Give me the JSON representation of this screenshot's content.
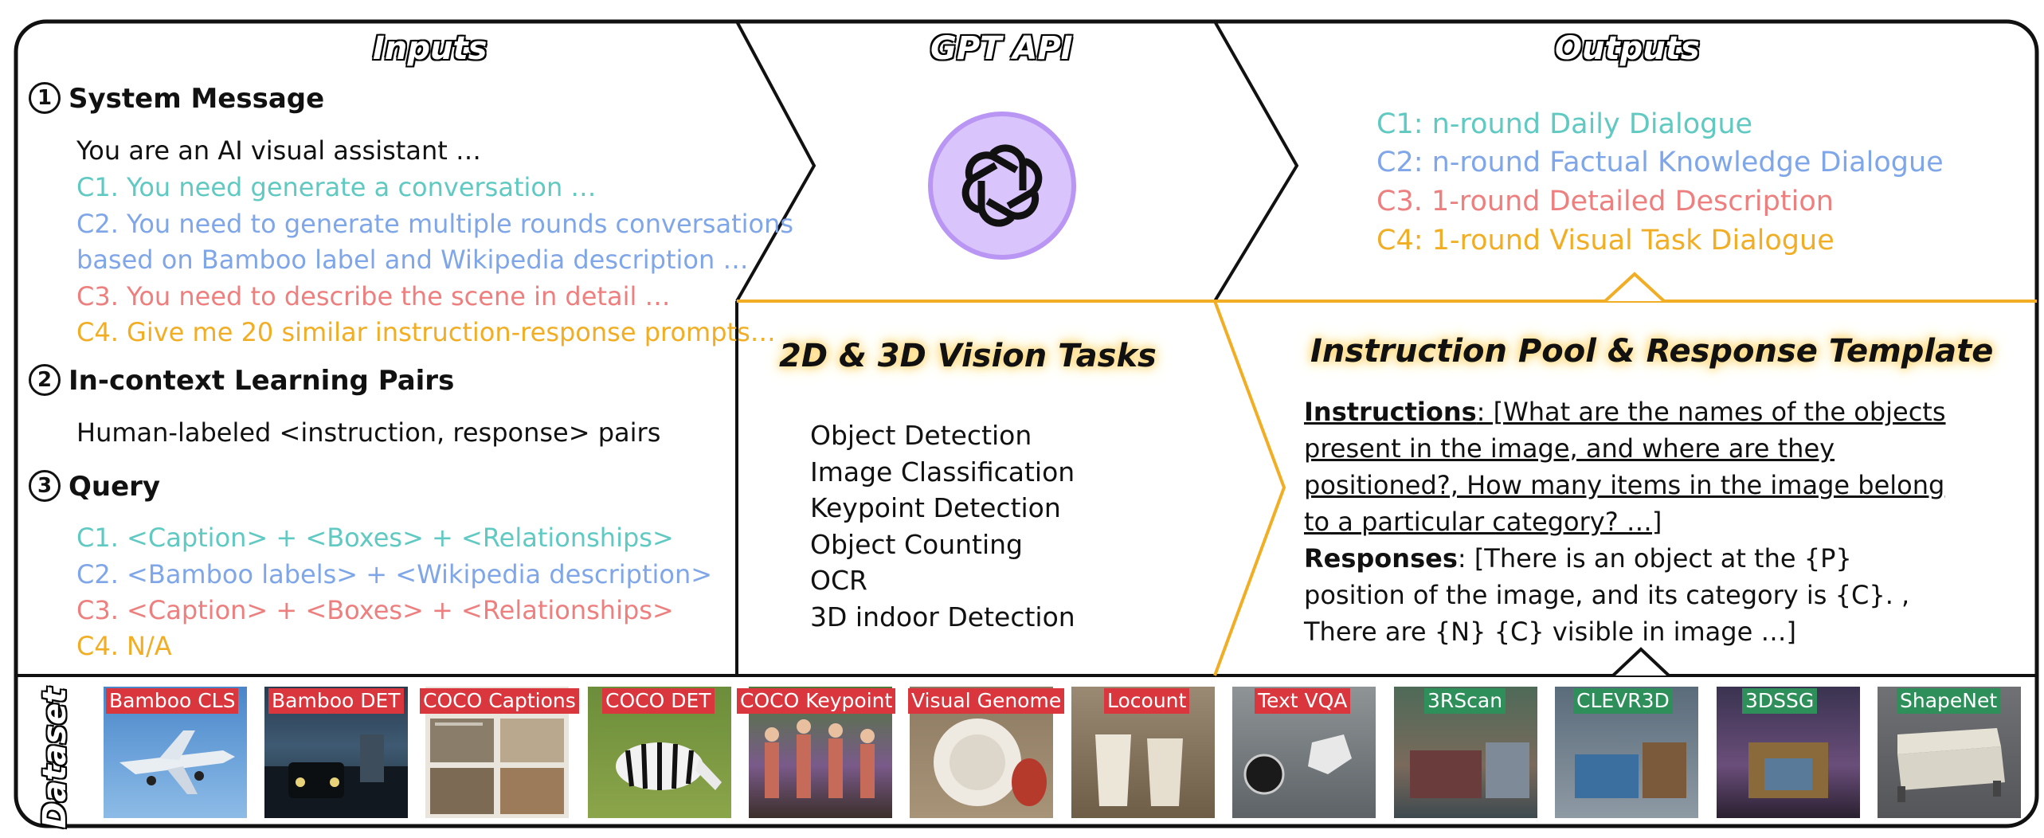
{
  "headers": {
    "inputs": "Inputs",
    "gpt": "GPT API",
    "outputs": "Outputs"
  },
  "inputs": {
    "system_message": {
      "num": "1",
      "title": "System Message",
      "intro": "You are an AI visual assistant …",
      "c1": "C1. You need generate a conversation …",
      "c2a": "C2. You need to generate multiple rounds conversations",
      "c2b": "based on Bamboo label and Wikipedia description …",
      "c3": "C3. You need to describe the scene in detail …",
      "c4": "C4. Give me 20 similar instruction-response prompts…"
    },
    "icl": {
      "num": "2",
      "title": "In-context Learning Pairs",
      "text": "Human-labeled <instruction, response> pairs"
    },
    "query": {
      "num": "3",
      "title": "Query",
      "c1": "C1. <Caption> + <Boxes> + <Relationships>",
      "c2": "C2. <Bamboo labels> + <Wikipedia description>",
      "c3": "C3. <Caption> + <Boxes> + <Relationships>",
      "c4": "C4. N/A"
    }
  },
  "outputs": {
    "c1": "C1: n-round Daily Dialogue",
    "c2": "C2: n-round Factual Knowledge Dialogue",
    "c3": "C3. 1-round Detailed Description",
    "c4": "C4: 1-round Visual Task Dialogue"
  },
  "vision": {
    "title": "2D & 3D Vision Tasks",
    "tasks": [
      "Object Detection",
      "Image Classification",
      "Keypoint Detection",
      "Object Counting",
      "OCR",
      "3D indoor Detection"
    ]
  },
  "pool": {
    "title": "Instruction Pool & Response Template",
    "instr_label": "Instructions",
    "instr_text": ": [What are the names of the objects present in the image, and where are they positioned?, How many items in the image belong to a particular category? …]",
    "resp_label": "Responses",
    "resp_text": ": [There is an object at the {P} position of the image, and its category is {C}. , There are {N} {C} visible in image …]"
  },
  "dataset": {
    "label": "Dataset",
    "items": [
      {
        "name": "Bamboo CLS",
        "tag": "red"
      },
      {
        "name": "Bamboo DET",
        "tag": "red"
      },
      {
        "name": "COCO Captions",
        "tag": "red"
      },
      {
        "name": "COCO DET",
        "tag": "red"
      },
      {
        "name": "COCO Keypoint",
        "tag": "red"
      },
      {
        "name": "Visual Genome",
        "tag": "red"
      },
      {
        "name": "Locount",
        "tag": "red"
      },
      {
        "name": "Text VQA",
        "tag": "red"
      },
      {
        "name": "3RScan",
        "tag": "green"
      },
      {
        "name": "CLEVR3D",
        "tag": "green"
      },
      {
        "name": "3DSSG",
        "tag": "green"
      },
      {
        "name": "ShapeNet",
        "tag": "green"
      }
    ]
  },
  "colors": {
    "c1": "#5fc9c2",
    "c2": "#7fa6e8",
    "c3": "#ee7f7f",
    "c4": "#f1ae24",
    "tag_red": "#d9363e",
    "tag_green": "#2f8f5a",
    "logo_bg": "#d9c4fb",
    "logo_ring": "#b995f4"
  },
  "icons": {
    "gpt": "openai-logo-icon"
  }
}
